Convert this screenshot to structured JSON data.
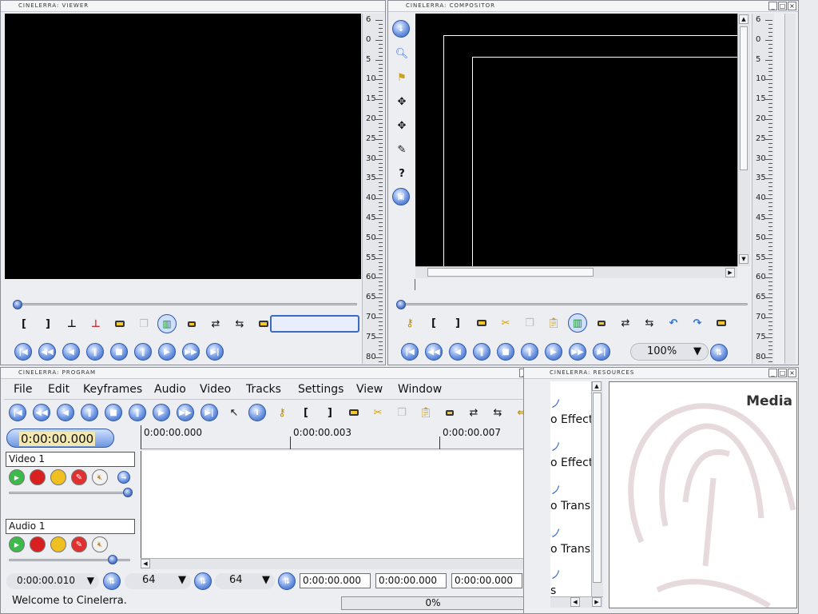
{
  "viewer": {
    "title": "CINELERRA: VIEWER"
  },
  "compositor": {
    "title": "CINELERRA: COMPOSITOR",
    "zoom": "100%"
  },
  "program": {
    "title": "CINELERRA: PROGRAM",
    "menu": [
      "File",
      "Edit",
      "Keyframes",
      "Audio",
      "Video",
      "Tracks",
      "Settings",
      "View",
      "Window"
    ],
    "clock": "0:00:00.000",
    "timeline_marks": [
      "0:00:00.000",
      "0:00:00.003",
      "0:00:00.007"
    ],
    "tracks": [
      {
        "label": "Video 1"
      },
      {
        "label": "Audio 1"
      }
    ],
    "zoom_time": "0:00:00.010",
    "sample_zoom": "64",
    "amp_zoom": "64",
    "sel_start": "0:00:00.000",
    "sel_len": "0:00:00.000",
    "sel_end": "0:00:00.000",
    "status": "Welcome to Cinelerra.",
    "progress": "0%",
    "progress_value": 0
  },
  "resources": {
    "title": "CINELERRA: RESOURCES",
    "heading": "Media",
    "folders": [
      "o Effect:",
      "o Effect:",
      "o Trans",
      "o Trans",
      "s"
    ]
  },
  "ruler_labels": [
    "6",
    "0",
    "5",
    "10",
    "15",
    "20",
    "25",
    "30",
    "35",
    "40",
    "45",
    "50",
    "55",
    "60",
    "65",
    "70",
    "75",
    "80"
  ]
}
